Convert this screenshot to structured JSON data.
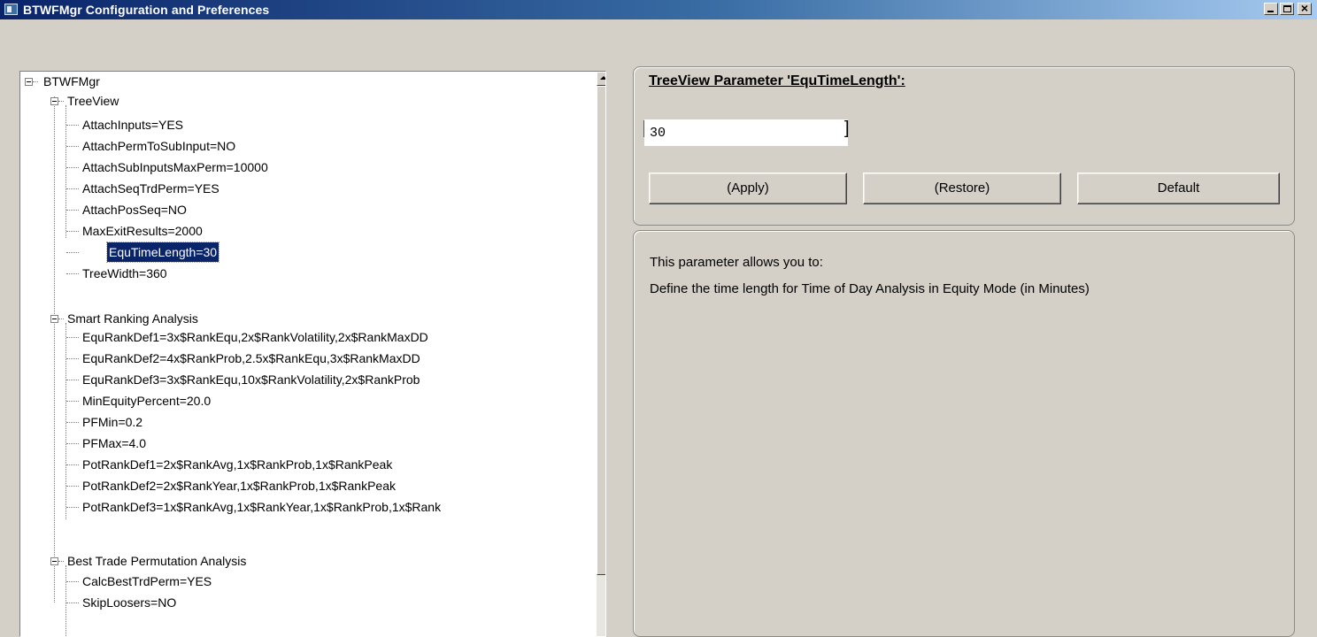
{
  "window": {
    "title": "BTWFMgr Configuration and Preferences",
    "icon": "app-window-icon",
    "controls": [
      "minimize-icon",
      "maximize-icon",
      "close-icon"
    ]
  },
  "tree": {
    "root": "BTWFMgr",
    "groups": [
      {
        "label": "TreeView",
        "items": [
          "AttachInputs=YES",
          "AttachPermToSubInput=NO",
          "AttachSubInputsMaxPerm=10000",
          "AttachSeqTrdPerm=YES",
          "AttachPosSeq=NO",
          "MaxExitResults=2000",
          "EquTimeLength=30",
          "TreeWidth=360"
        ]
      },
      {
        "label": "Smart Ranking Analysis",
        "items": [
          "EquRankDef1=3x$RankEqu,2x$RankVolatility,2x$RankMaxDD",
          "EquRankDef2=4x$RankProb,2.5x$RankEqu,3x$RankMaxDD",
          "EquRankDef3=3x$RankEqu,10x$RankVolatility,2x$RankProb",
          "MinEquityPercent=20.0",
          "PFMin=0.2",
          "PFMax=4.0",
          "PotRankDef1=2x$RankAvg,1x$RankProb,1x$RankPeak",
          "PotRankDef2=2x$RankYear,1x$RankProb,1x$RankPeak",
          "PotRankDef3=1x$RankAvg,1x$RankYear,1x$RankProb,1x$Rank"
        ]
      },
      {
        "label": "Best Trade Permutation Analysis",
        "items": [
          "CalcBestTrdPerm=YES",
          "SkipLoosers=NO"
        ]
      }
    ],
    "selected": "EquTimeLength=30"
  },
  "parameter": {
    "title": "TreeView Parameter 'EquTimeLength':",
    "value": "30",
    "bracket_open": "[",
    "bracket_close": "]"
  },
  "buttons": {
    "apply": "(Apply)",
    "restore": "(Restore)",
    "default": "Default"
  },
  "description": {
    "line1": "This parameter allows you to:",
    "line2": "Define the time length for Time of Day Analysis in Equity Mode (in Minutes)"
  }
}
